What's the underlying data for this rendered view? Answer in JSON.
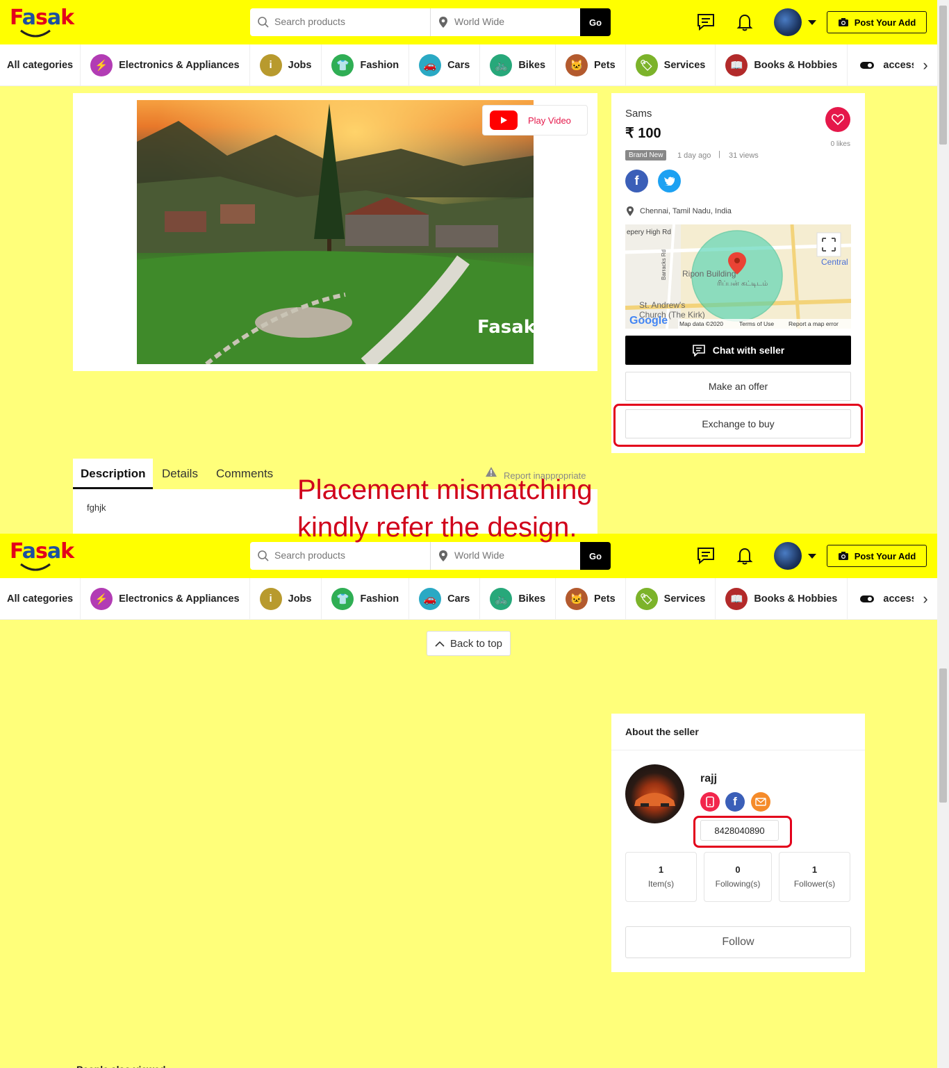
{
  "brand": {
    "logo_text": "Fasak",
    "logo_colors": [
      "#e3001b",
      "#1d4fa1",
      "#e3001b",
      "#1d4fa1",
      "#e3001b"
    ]
  },
  "header": {
    "search_placeholder": "Search products",
    "location_placeholder": "World Wide",
    "go_label": "Go",
    "post_label": "Post Your Add"
  },
  "categories": [
    {
      "label": "All categories"
    },
    {
      "label": "Electronics & Appliances",
      "color": "#b23cb4",
      "icon": "plug-icon"
    },
    {
      "label": "Jobs",
      "color": "#b89a2e",
      "icon": "info-icon"
    },
    {
      "label": "Fashion",
      "color": "#2fae54",
      "icon": "tshirt-icon"
    },
    {
      "label": "Cars",
      "color": "#2aa9c4",
      "icon": "car-icon"
    },
    {
      "label": "Bikes",
      "color": "#27a87a",
      "icon": "bike-icon"
    },
    {
      "label": "Pets",
      "color": "#b35a2e",
      "icon": "pet-icon"
    },
    {
      "label": "Services",
      "color": "#7cb32a",
      "icon": "tag-icon"
    },
    {
      "label": "Books & Hobbies",
      "color": "#b22a2a",
      "icon": "book-icon"
    },
    {
      "label": "accessory",
      "color": "#ffffff",
      "icon": "toggle-icon"
    }
  ],
  "product": {
    "play_video": "Play Video",
    "image_watermark": "Fasak",
    "title": "Sams",
    "price": "₹ 100",
    "likes": "0 likes",
    "condition": "Brand New",
    "posted": "1 day ago",
    "views": "31 views",
    "location": "Chennai, Tamil Nadu, India",
    "chat_label": "Chat with seller",
    "offer_label": "Make an offer",
    "exchange_label": "Exchange to buy"
  },
  "map": {
    "labels": [
      "epery High Rd",
      "Barracks Rd",
      "Ripon Building",
      "ரிப்பன் கட்டிடம்",
      "St. Andrew's",
      "Church (The Kirk)",
      "Central",
      "Google",
      "Map data ©2020",
      "Terms of Use",
      "Report a map error"
    ]
  },
  "tabs": {
    "items": [
      "Description",
      "Details",
      "Comments"
    ],
    "active": "Description",
    "report": "Report inappropriate"
  },
  "description": "fghjk",
  "annotation": {
    "line1": "Placement mismatching",
    "line2": "kindly refer the design."
  },
  "back_to_top": "Back to top",
  "seller": {
    "heading": "About the seller",
    "name": "rajj",
    "phone": "8428040890",
    "stats": [
      {
        "value": "1",
        "label": "Item(s)"
      },
      {
        "value": "0",
        "label": "Following(s)"
      },
      {
        "value": "1",
        "label": "Follower(s)"
      }
    ],
    "follow_label": "Follow"
  },
  "footer_partial": "People also viewed"
}
